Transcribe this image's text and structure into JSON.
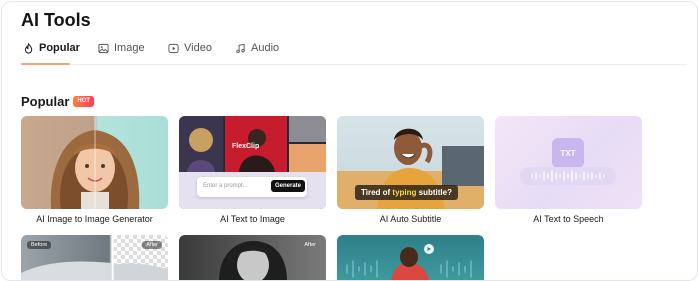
{
  "header": {
    "title": "AI Tools"
  },
  "tabs": [
    {
      "label": "Popular",
      "icon": "flame-icon",
      "active": true
    },
    {
      "label": "Image",
      "icon": "image-icon",
      "active": false
    },
    {
      "label": "Video",
      "icon": "play-icon",
      "active": false
    },
    {
      "label": "Audio",
      "icon": "music-icon",
      "active": false
    }
  ],
  "section": {
    "title": "Popular",
    "badge": "HOT"
  },
  "tools": [
    {
      "label": "AI Image to Image Generator"
    },
    {
      "label": "AI Text to Image",
      "prompt_placeholder": "Enter a prompt...",
      "generate_label": "Generate",
      "brand_text": "FlexClip"
    },
    {
      "label": "AI Auto Subtitle",
      "caption_prefix": "Tired of ",
      "caption_highlight": "typing",
      "caption_suffix": " subtitle?"
    },
    {
      "label": "AI Text to Speech",
      "file_text": "TXT"
    }
  ],
  "second_row": [
    {
      "before_label": "Before",
      "after_label": "After"
    },
    {
      "after_label": "After"
    },
    {}
  ],
  "colors": {
    "accent": "#f0a27a",
    "hot_start": "#ff7e3b",
    "hot_end": "#ff3d5b",
    "highlight": "#ffd84a"
  }
}
